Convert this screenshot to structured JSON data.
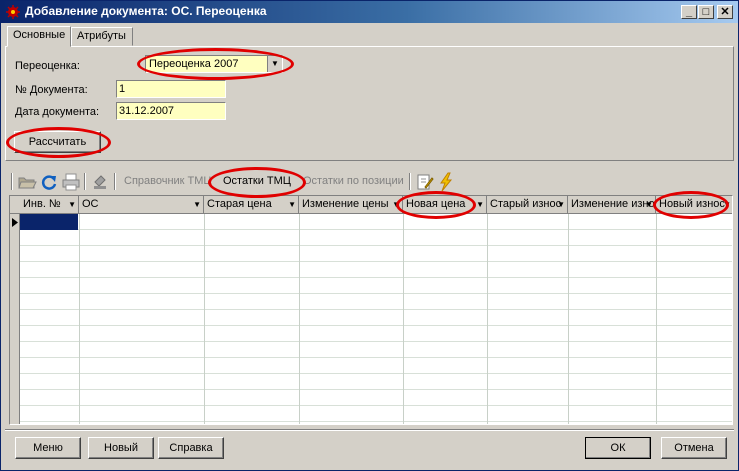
{
  "window": {
    "title": "Добавление документа: ОС. Переоценка",
    "controls": {
      "minimize": "_",
      "maximize": "□",
      "close": "✕"
    }
  },
  "tabs": [
    {
      "label": "Основные",
      "active": true
    },
    {
      "label": "Атрибуты",
      "active": false
    }
  ],
  "form": {
    "revaluation_label": "Переоценка:",
    "revaluation_value": "Переоценка 2007",
    "doc_number_label": "№ Документа:",
    "doc_number_value": "1",
    "doc_date_label": "Дата документа:",
    "doc_date_value": "31.12.2007",
    "calculate_button": "Рассчитать"
  },
  "toolbar": {
    "tmc_directory": "Справочник ТМЦ",
    "tmc_balances": "Остатки ТМЦ",
    "balances_by_position": "Остатки по позиции"
  },
  "grid": {
    "columns": [
      "Инв. №",
      "ОС",
      "Старая цена",
      "Изменение цены",
      "Новая цена",
      "Старый износ",
      "Изменение износа",
      "Новый износ"
    ],
    "row_count": 13
  },
  "footer": {
    "menu_button": "Меню",
    "new_button": "Новый",
    "help_button": "Справка",
    "ok_button": "ОК",
    "cancel_button": "Отмена"
  },
  "colors": {
    "title_bar": "#0a246a",
    "field_background": "#ffffc0",
    "highlight_ellipse": "#e00000",
    "selected_cell": "#0a246a"
  }
}
